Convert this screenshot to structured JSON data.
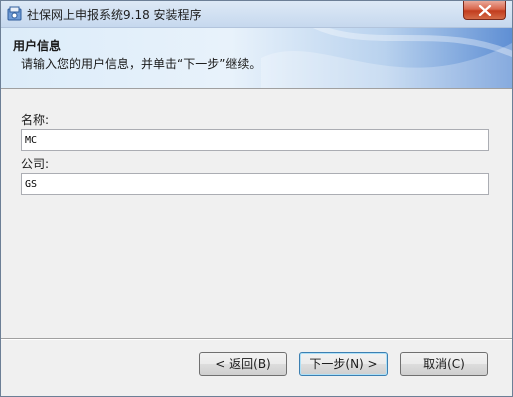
{
  "window": {
    "title": "社保网上申报系统9.18 安装程序"
  },
  "banner": {
    "title": "用户信息",
    "subtitle": "请输入您的用户信息，并单击“下一步”继续。"
  },
  "form": {
    "name_label": "名称:",
    "name_value": "MC",
    "company_label": "公司:",
    "company_value": "GS"
  },
  "buttons": {
    "back": "< 返回(B)",
    "next": "下一步(N) >",
    "cancel": "取消(C)"
  },
  "colors": {
    "close_button": "#c94a2c",
    "banner_accent": "#5f8fd4"
  }
}
